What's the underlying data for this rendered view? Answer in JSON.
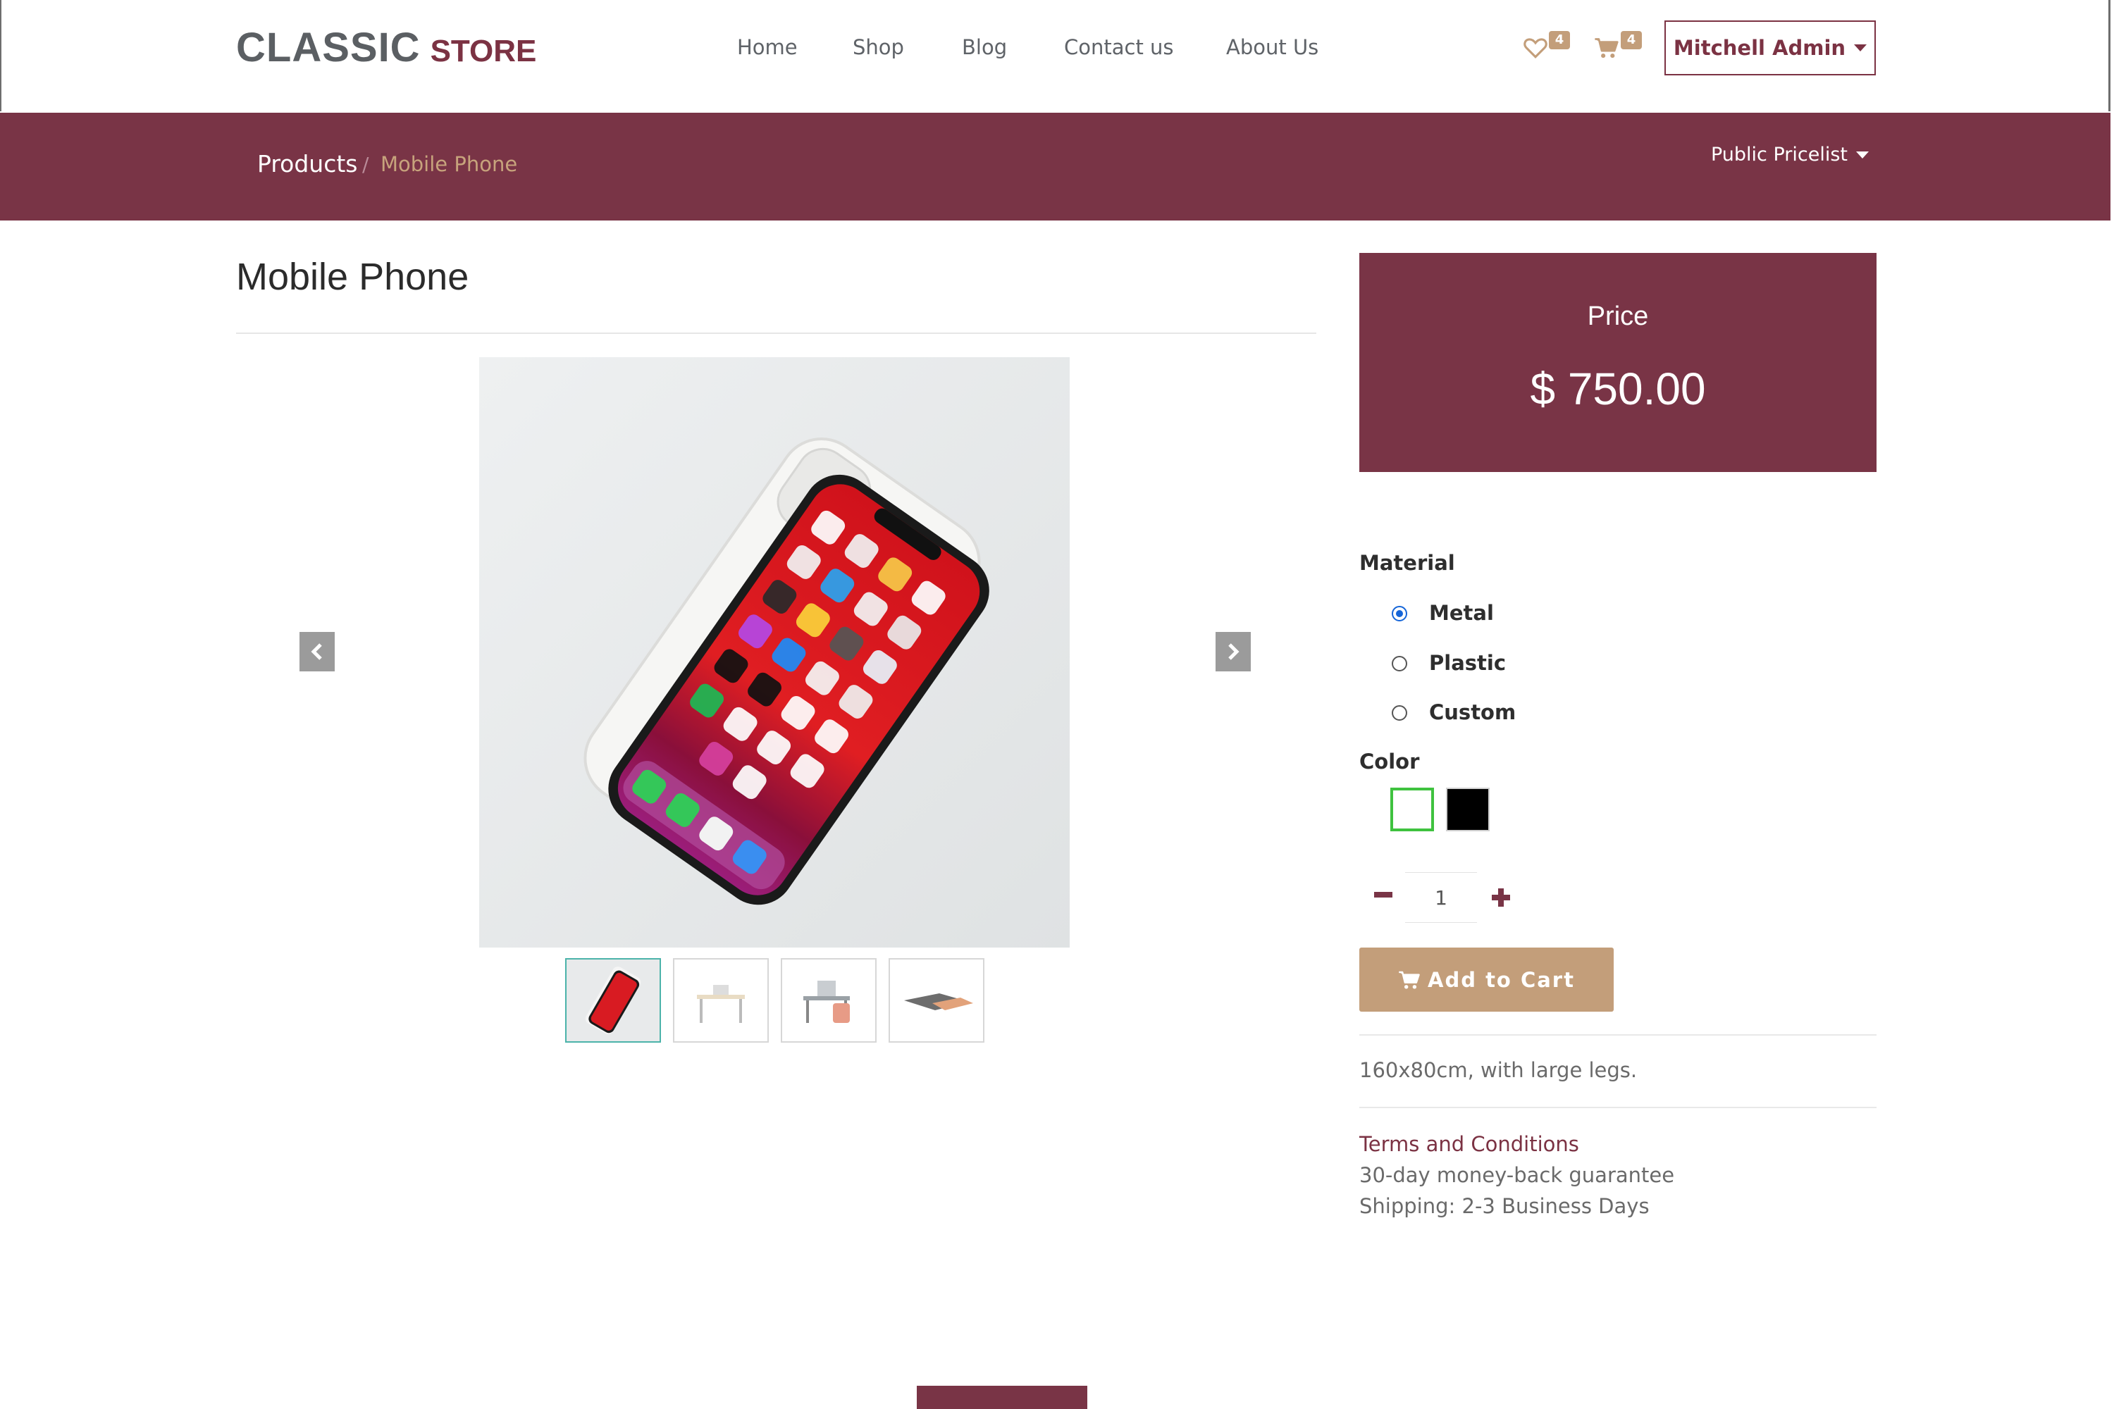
{
  "header": {
    "logo_main": "CLASSIC",
    "logo_sub": "STORE",
    "nav": [
      {
        "label": "Home"
      },
      {
        "label": "Shop"
      },
      {
        "label": "Blog"
      },
      {
        "label": "Contact us"
      },
      {
        "label": "About Us"
      }
    ],
    "wishlist_count": "4",
    "cart_count": "4",
    "user_label": "Mitchell Admin"
  },
  "breadcrumb": {
    "parent": "Products",
    "separator": "/",
    "current": "Mobile Phone"
  },
  "pricelist_label": "Public Pricelist",
  "product": {
    "title": "Mobile Phone",
    "price_label": "Price",
    "price": "$ 750.00",
    "material_label": "Material",
    "materials": [
      {
        "label": "Metal",
        "selected": true
      },
      {
        "label": "Plastic",
        "selected": false
      },
      {
        "label": "Custom",
        "selected": false
      }
    ],
    "color_label": "Color",
    "colors": [
      {
        "name": "white",
        "hex": "#ffffff",
        "selected": true
      },
      {
        "name": "black",
        "hex": "#000000",
        "selected": false
      }
    ],
    "quantity": "1",
    "add_to_cart": "Add to Cart",
    "description": "160x80cm, with large legs.",
    "terms_link": "Terms and Conditions",
    "guarantee": "30-day money-back guarantee",
    "shipping": "Shipping: 2-3 Business Days"
  },
  "colors": {
    "brand": "#793446",
    "accent": "#c39e7a",
    "active_thumb_border": "#4bb3aa"
  }
}
